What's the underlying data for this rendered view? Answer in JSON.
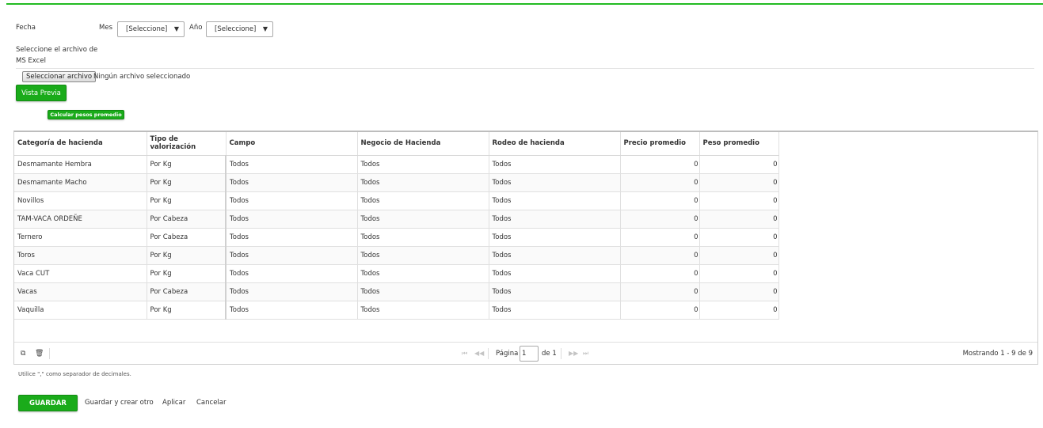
{
  "form": {
    "fecha_label": "Fecha",
    "mes_label": "Mes",
    "mes_value": "[Seleccione]",
    "anio_label": "Año",
    "anio_value": "[Seleccione]",
    "file_label_line1": "Seleccione el archivo de",
    "file_label_line2": "MS Excel",
    "file_button": "Seleccionar archivo",
    "file_status": "Ningún archivo seleccionado",
    "preview_button": "Vista Previa",
    "calc_button": "Calcular pesos promedio"
  },
  "grid": {
    "columns": [
      "Categoría de hacienda",
      "Tipo de valorización",
      "Campo",
      "Negocio de Hacienda",
      "Rodeo de hacienda",
      "Precio promedio",
      "Peso promedio"
    ],
    "rows": [
      [
        "Desmamante Hembra",
        "Por Kg",
        "Todos",
        "Todos",
        "Todos",
        "0",
        "0"
      ],
      [
        "Desmamante Macho",
        "Por Kg",
        "Todos",
        "Todos",
        "Todos",
        "0",
        "0"
      ],
      [
        "Novillos",
        "Por Kg",
        "Todos",
        "Todos",
        "Todos",
        "0",
        "0"
      ],
      [
        "TAM-VACA ORDEÑE",
        "Por Cabeza",
        "Todos",
        "Todos",
        "Todos",
        "0",
        "0"
      ],
      [
        "Ternero",
        "Por Cabeza",
        "Todos",
        "Todos",
        "Todos",
        "0",
        "0"
      ],
      [
        "Toros",
        "Por Kg",
        "Todos",
        "Todos",
        "Todos",
        "0",
        "0"
      ],
      [
        "Vaca CUT",
        "Por Kg",
        "Todos",
        "Todos",
        "Todos",
        "0",
        "0"
      ],
      [
        "Vacas",
        "Por Cabeza",
        "Todos",
        "Todos",
        "Todos",
        "0",
        "0"
      ],
      [
        "Vaquilla",
        "Por Kg",
        "Todos",
        "Todos",
        "Todos",
        "0",
        "0"
      ]
    ]
  },
  "pager": {
    "page_label": "Página",
    "page_value": "1",
    "of_label": "de 1",
    "showing": "Mostrando 1 - 9 de 9"
  },
  "footer": {
    "hint": "Utilice \",\" como separador de decimales.",
    "save": "GUARDAR",
    "save_new": "Guardar y crear otro",
    "apply": "Aplicar",
    "cancel": "Cancelar"
  },
  "colors": {
    "accent": "#1aab1a",
    "top_border": "#22bb22"
  }
}
